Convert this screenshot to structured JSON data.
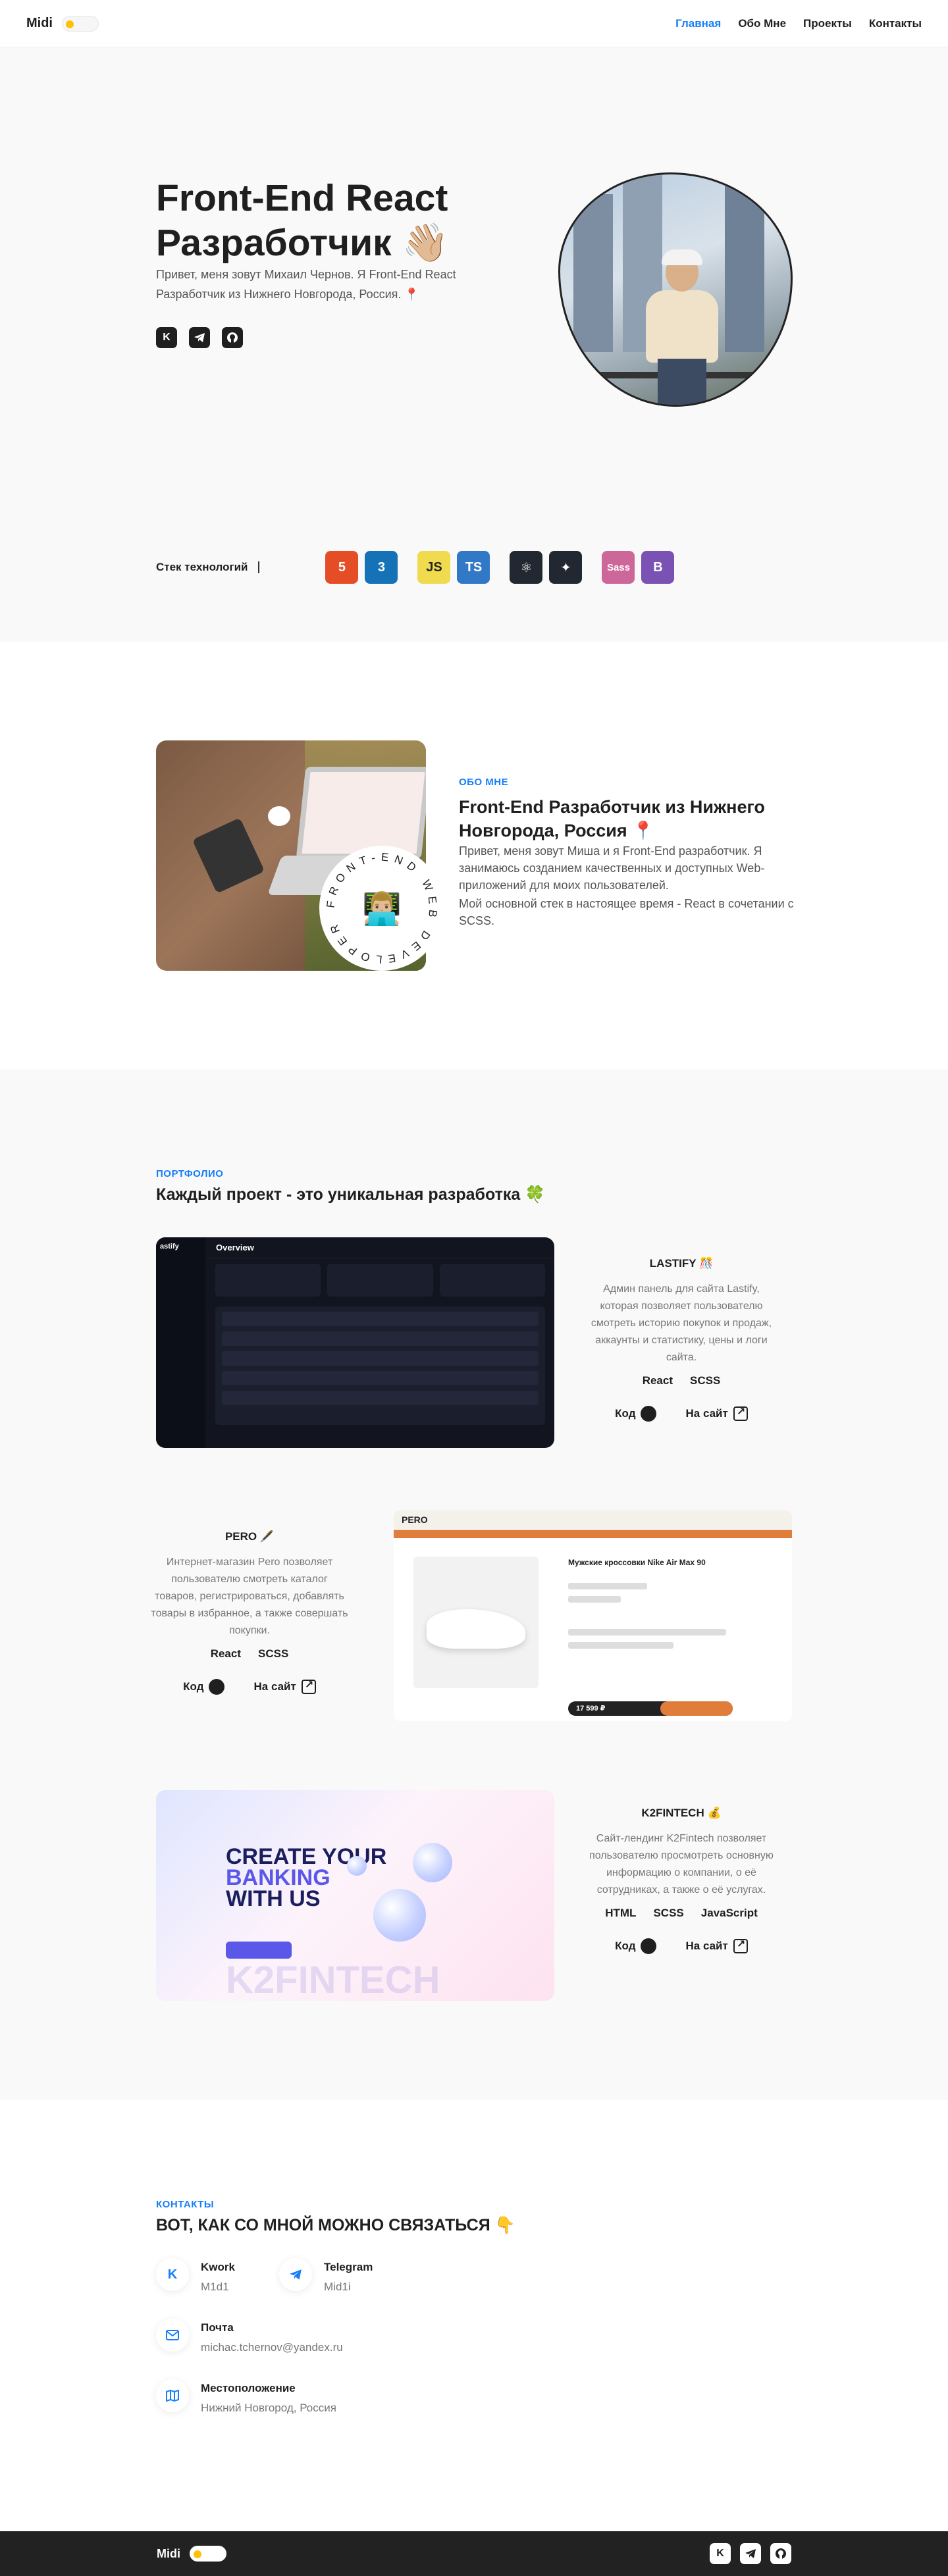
{
  "header": {
    "logo": "Midi",
    "nav": [
      "Главная",
      "Обо Мне",
      "Проекты",
      "Контакты"
    ]
  },
  "hero": {
    "title": "Front-End React Разработчик 👋🏼",
    "text": "Привет, меня зовут Михаил Чернов. Я Front-End React Разработчик из Нижнего Новгорода, Россия. 📍",
    "social_icons": [
      "kwork-icon",
      "telegram-icon",
      "github-icon"
    ],
    "stack_label": "Стек технологий",
    "stack": [
      [
        {
          "name": "html5-icon",
          "label": "5",
          "color": "#e44d26"
        },
        {
          "name": "css3-icon",
          "label": "3",
          "color": "#1572b6"
        }
      ],
      [
        {
          "name": "javascript-icon",
          "label": "JS",
          "color": "#f0db4f"
        },
        {
          "name": "typescript-icon",
          "label": "TS",
          "color": "#3178c6"
        }
      ],
      [
        {
          "name": "react-icon",
          "label": "⚛",
          "color": "#222831"
        },
        {
          "name": "figma-icon",
          "label": "✦",
          "color": "#222831"
        }
      ],
      [
        {
          "name": "sass-icon",
          "label": "Sass",
          "color": "#cd6799"
        },
        {
          "name": "bootstrap-icon",
          "label": "B",
          "color": "#7952b3"
        }
      ]
    ]
  },
  "about": {
    "tag": "ОБО МНЕ",
    "title": "Front-End Разработчик из Нижнего Новгорода, Россия 📍",
    "p1": "Привет, меня зовут Миша и я Front-End разработчик. Я занимаюсь созданием качественных и доступных Web-приложений для моих пользователей.",
    "p2": "Мой основной стек в настоящее время - React в сочетании с SCSS.",
    "badge_text": "FRONT-END WEB DEVELOPER",
    "badge_emoji": "👨🏼‍💻"
  },
  "portfolio": {
    "tag": "ПОРТФОЛИО",
    "title": "Каждый проект - это уникальная разработка 🍀",
    "code_label": "Код",
    "site_label": "На сайт",
    "projects": [
      {
        "name": "LASTIFY 🎊",
        "desc": "Админ панель для сайта Lastify, которая позволяет пользователю смотреть историю покупок и продаж, аккаунты и статистику, цены и логи сайта.",
        "tech": [
          "React",
          "SCSS"
        ]
      },
      {
        "name": "PERO 🖋️",
        "desc": "Интернет-магазин Pero позволяет пользователю смотреть каталог товаров, регистрироваться, добавлять товары в избранное, а также совершать покупки.",
        "tech": [
          "React",
          "SCSS"
        ]
      },
      {
        "name": "K2FINTECH 💰",
        "desc": "Сайт-лендинг K2Fintech позволяет пользователю просмотреть основную информацию о компании, о её сотрудниках, а также о её услугах.",
        "tech": [
          "HTML",
          "SCSS",
          "JavaScript"
        ]
      }
    ],
    "lastify_screen": {
      "title": "Overview",
      "brand": "astify"
    },
    "pero_screen": {
      "logo": "PERO",
      "product": "Мужские кроссовки Nike Air Max 90",
      "price": "17 599 ₽"
    },
    "k2_screen": {
      "headline_1": "CREATE YOUR",
      "headline_2": "BANKING",
      "headline_3": "WITH US",
      "watermark": "K2FINTECH"
    }
  },
  "contacts": {
    "tag": "КОНТАКТЫ",
    "title": "ВОТ, КАК СО МНОЙ МОЖНО СВЯЗАТЬСЯ 👇",
    "items": [
      {
        "label": "Kwork",
        "value": "M1d1",
        "icon": "kwork-icon"
      },
      {
        "label": "Telegram",
        "value": "Mid1i",
        "icon": "telegram-icon"
      },
      {
        "label": "Почта",
        "value": "michac.tchernov@yandex.ru",
        "icon": "mail-icon"
      },
      {
        "label": "Местоположение",
        "value": "Нижний Новгород, Россия",
        "icon": "map-icon"
      }
    ]
  },
  "footer": {
    "logo": "Midi",
    "social_icons": [
      "kwork-icon",
      "telegram-icon",
      "github-icon"
    ]
  }
}
